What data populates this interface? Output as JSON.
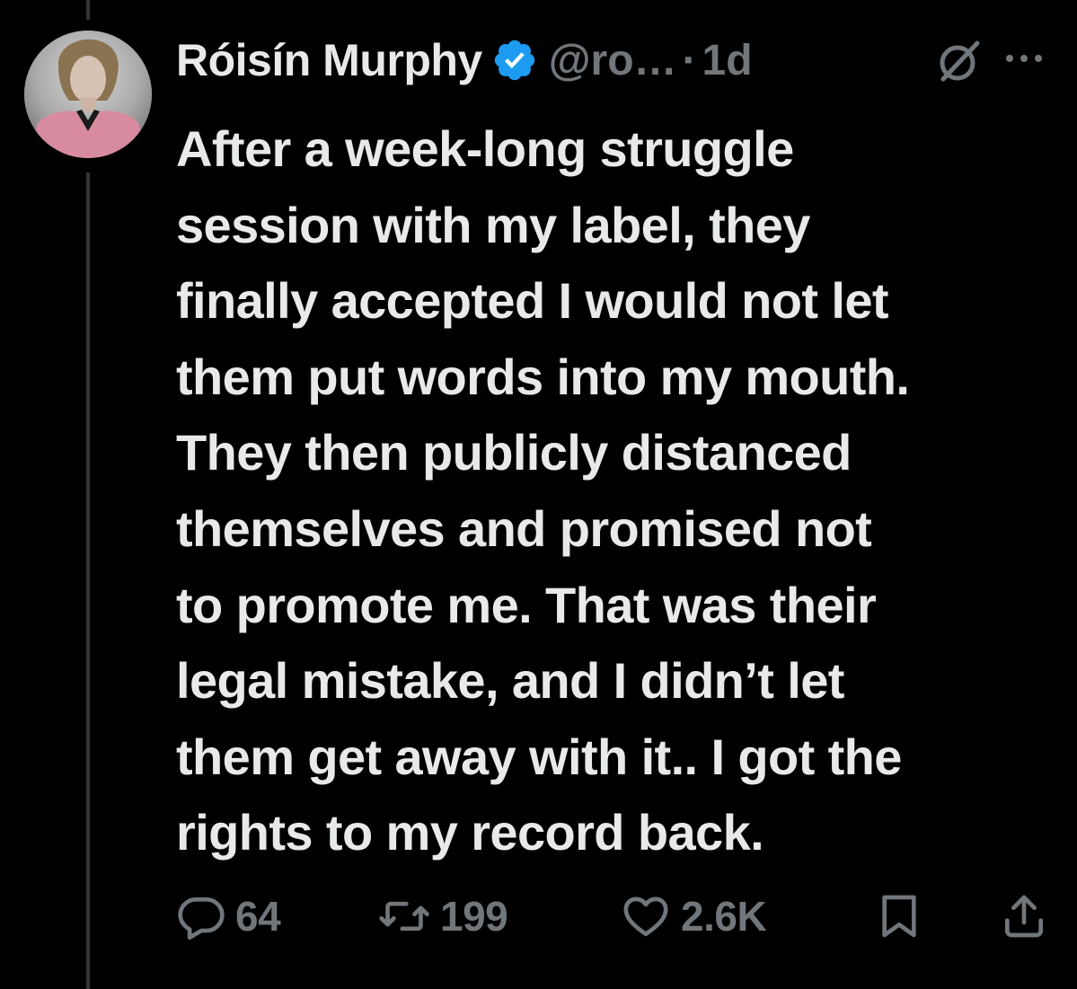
{
  "tweet": {
    "display_name": "Róisín Murphy",
    "handle": "@ro…",
    "separator": "·",
    "time": "1d",
    "text_lines": [
      "After a week-long struggle",
      "session with my label, they",
      "finally accepted I would not let",
      "them put words into my mouth.",
      "They then publicly distanced",
      "themselves and promised not",
      "to promote me. That was their",
      "legal mistake, and I didn’t let",
      "them get away with it.. I got the",
      "rights to my record back."
    ],
    "verified_color": "#1d9bf0"
  },
  "icons": {
    "avatar": "avatar-photo",
    "verified": "verified-badge-icon",
    "grok": "grok-icon",
    "more": "more-icon",
    "reply": "reply-icon",
    "retweet": "retweet-icon",
    "like": "heart-icon",
    "bookmark": "bookmark-icon",
    "share": "share-icon"
  },
  "actions": {
    "replies": "64",
    "retweets": "199",
    "likes": "2.6K"
  },
  "colors": {
    "background": "#000000",
    "text": "#e7e9ea",
    "secondary": "#71767b"
  }
}
